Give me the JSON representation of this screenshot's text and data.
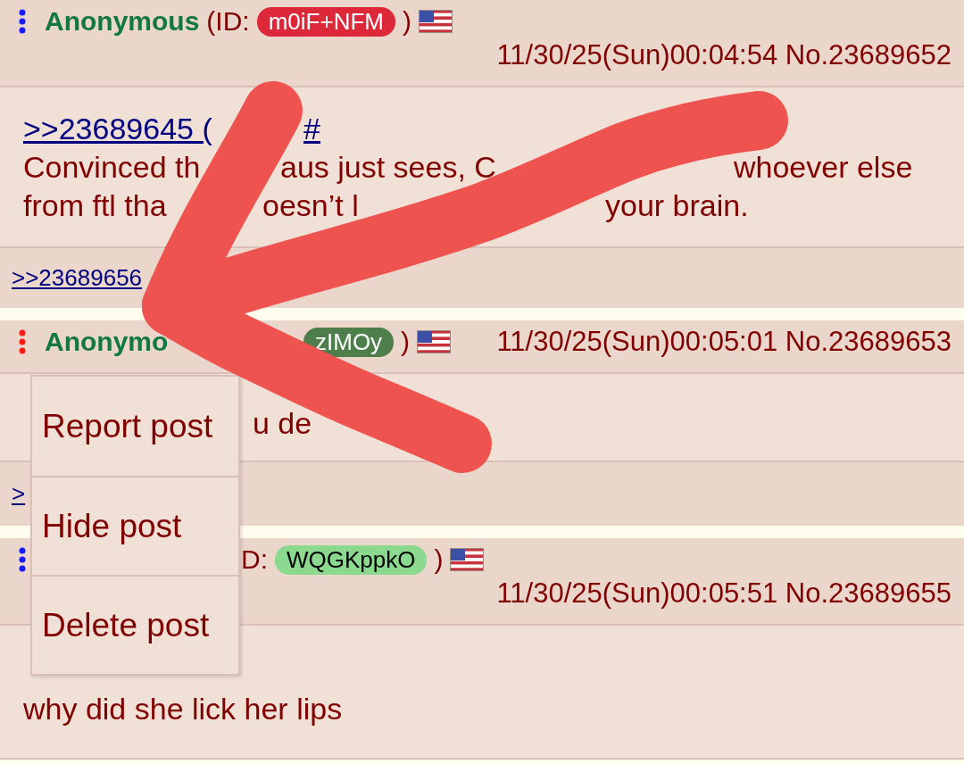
{
  "posts": [
    {
      "menu_open": false,
      "header": [
        {
          "kind": "name",
          "text": "Anonymous"
        },
        {
          "kind": "text",
          "text": "(ID:"
        },
        {
          "kind": "badge",
          "text": "m0iF+NFM",
          "color": "#dc2838"
        },
        {
          "kind": "text",
          "text": ")"
        },
        {
          "kind": "flag"
        }
      ],
      "date": "11/30/25(Sun)00:04:54 No.23689652",
      "lines": [
        [
          {
            "kind": "link",
            "text": ">>23689645 ("
          },
          {
            "kind": "link",
            "text": "#"
          }
        ],
        [
          {
            "kind": "text",
            "text": "Convinced th"
          },
          {
            "kind": "text",
            "text": "aus just sees, C"
          },
          {
            "kind": "text",
            "text": "whoever else"
          }
        ],
        [
          {
            "kind": "text",
            "text": "from ftl tha"
          },
          {
            "kind": "text",
            "text": "oesn’t l"
          },
          {
            "kind": "text",
            "text": "your brain."
          }
        ]
      ],
      "replies": [
        ">>23689656"
      ]
    },
    {
      "menu_open": true,
      "header": [
        {
          "kind": "name",
          "text": "Anonymo"
        },
        {
          "kind": "badge",
          "text": "zIMOy",
          "color": "#4e7f4b"
        },
        {
          "kind": "text",
          "text": ")"
        },
        {
          "kind": "flag"
        }
      ],
      "date": "11/30/25(Sun)00:05:01 No.23689653",
      "lines": [
        [
          {
            "kind": "text",
            "text": "u de"
          }
        ]
      ],
      "replies": [
        ">"
      ]
    },
    {
      "menu_open": false,
      "header": [
        {
          "kind": "text",
          "text": "D:"
        },
        {
          "kind": "badge",
          "text": "WQGKppkO",
          "color": "#8bd98f"
        },
        {
          "kind": "text",
          "text": ")"
        },
        {
          "kind": "flag"
        }
      ],
      "date": "11/30/25(Sun)00:05:51 No.23689655",
      "lines": [
        [
          {
            "kind": "text",
            "text": "why did she lick her lips"
          }
        ]
      ]
    }
  ],
  "menu": {
    "items": [
      {
        "label": "Report post"
      },
      {
        "label": "Hide post"
      },
      {
        "label": "Delete post"
      }
    ]
  }
}
